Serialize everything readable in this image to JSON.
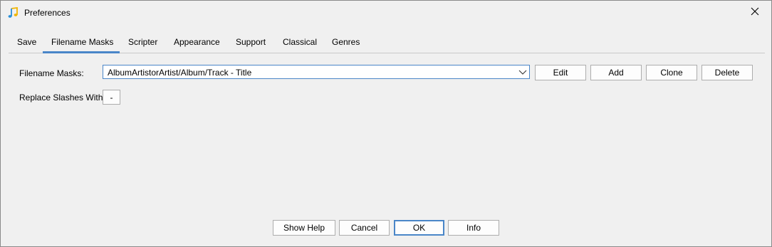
{
  "window": {
    "title": "Preferences"
  },
  "tabs": [
    {
      "label": "Save"
    },
    {
      "label": "Filename Masks"
    },
    {
      "label": "Scripter"
    },
    {
      "label": "Appearance"
    },
    {
      "label": "Support"
    },
    {
      "label": "Classical"
    },
    {
      "label": "Genres"
    }
  ],
  "active_tab": "Filename Masks",
  "masks": {
    "label": "Filename Masks:",
    "value": "AlbumArtistorArtist/Album/Track - Title",
    "edit_label": "Edit",
    "add_label": "Add",
    "clone_label": "Clone",
    "delete_label": "Delete"
  },
  "slashes": {
    "label": "Replace Slashes With",
    "value": "-"
  },
  "footer": {
    "show_help_label": "Show Help",
    "cancel_label": "Cancel",
    "ok_label": "OK",
    "info_label": "Info"
  },
  "colors": {
    "accent": "#4a86c8",
    "background": "#f0f0f0"
  },
  "icons": {
    "app": "music-note-icon",
    "close": "close-icon",
    "dropdown": "chevron-down-icon"
  }
}
